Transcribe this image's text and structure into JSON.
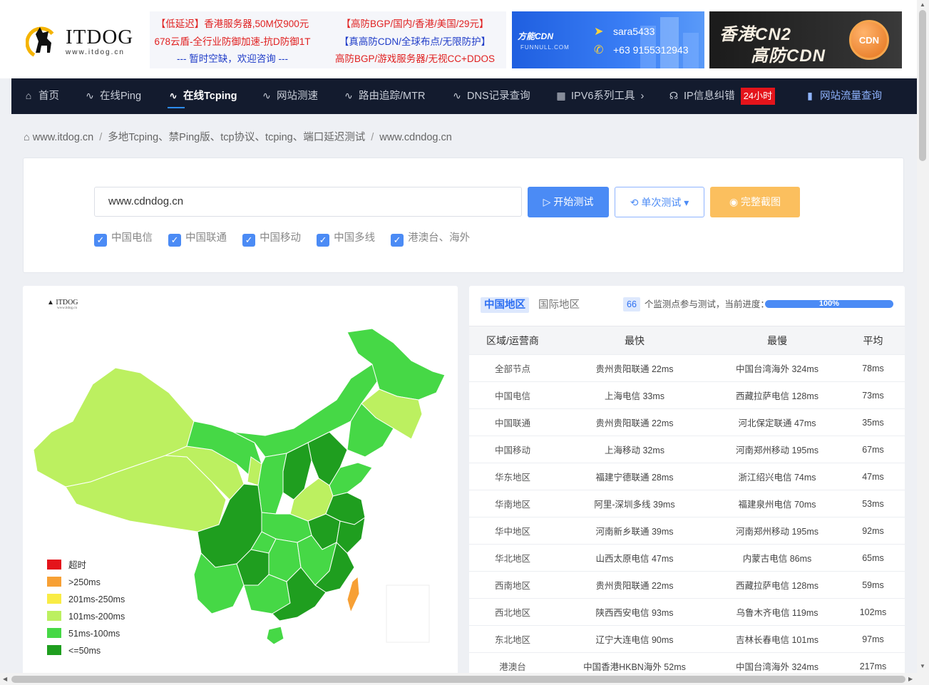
{
  "logo": {
    "title": "ITDOG",
    "url": "www.itdog.cn"
  },
  "ads": {
    "left": [
      "【低延迟】香港服务器,50M仅900元",
      "678云盾-全行业防御加速-抗D防御1T",
      "--- 暂时空缺，欢迎咨询 ---"
    ],
    "right": [
      "【高防BGP/国内/香港/美国/29元】",
      "【真高防CDN/全球布点/无限防护】",
      "高防BGP/游戏服务器/无视CC+DDOS"
    ]
  },
  "funnull": {
    "brand": "方能CDN",
    "brand_sub": "FUNNULL.COM",
    "telegram": "sara5433",
    "phone": "+63 9155312943"
  },
  "cn2_ad": {
    "line1": "香港CN2",
    "line2": "高防CDN",
    "badge": "CDN"
  },
  "nav": {
    "items": [
      "首页",
      "在线Ping",
      "在线Tcping",
      "网站测速",
      "路由追踪/MTR",
      "DNS记录查询",
      "IPV6系列工具",
      "IP信息纠错",
      "网站流量查询"
    ],
    "hot_badge": "24小时"
  },
  "breadcrumb": [
    "www.itdog.cn",
    "多地Tcping、禁Ping版、tcp协议、tcping、端口延迟测试",
    "www.cdndog.cn"
  ],
  "search": {
    "value": "www.cdndog.cn",
    "start_label": "开始测试",
    "mode_label": "单次测试",
    "screenshot_label": "完整截图"
  },
  "checkboxes": [
    "中国电信",
    "中国联通",
    "中国移动",
    "中国多线",
    "港澳台、海外"
  ],
  "map": {
    "logo": "ITDOG",
    "logo_url": "www.itdog.cn",
    "legend": [
      "超时",
      ">250ms",
      "201ms-250ms",
      "101ms-200ms",
      "51ms-100ms",
      "<=50ms"
    ],
    "colors": [
      "#e4141b",
      "#f7a035",
      "#f9ec45",
      "#bcf060",
      "#46d846",
      "#1f9e1f"
    ]
  },
  "results": {
    "tabs": [
      "中国地区",
      "国际地区"
    ],
    "node_count": "66",
    "progress_text": "个监测点参与测试，当前进度：",
    "progress": "100%",
    "headers": [
      "区域/运营商",
      "最快",
      "最慢",
      "平均"
    ],
    "rows": [
      [
        "全部节点",
        "贵州贵阳联通 22ms",
        "中国台湾海外 324ms",
        "78ms"
      ],
      [
        "中国电信",
        "上海电信 33ms",
        "西藏拉萨电信 128ms",
        "73ms"
      ],
      [
        "中国联通",
        "贵州贵阳联通 22ms",
        "河北保定联通 47ms",
        "35ms"
      ],
      [
        "中国移动",
        "上海移动 32ms",
        "河南郑州移动 195ms",
        "67ms"
      ],
      [
        "华东地区",
        "福建宁德联通 28ms",
        "浙江绍兴电信 74ms",
        "47ms"
      ],
      [
        "华南地区",
        "阿里-深圳多线 39ms",
        "福建泉州电信 70ms",
        "53ms"
      ],
      [
        "华中地区",
        "河南新乡联通 39ms",
        "河南郑州移动 195ms",
        "92ms"
      ],
      [
        "华北地区",
        "山西太原电信 47ms",
        "内蒙古电信 86ms",
        "65ms"
      ],
      [
        "西南地区",
        "贵州贵阳联通 22ms",
        "西藏拉萨电信 128ms",
        "59ms"
      ],
      [
        "西北地区",
        "陕西西安电信 93ms",
        "乌鲁木齐电信 119ms",
        "102ms"
      ],
      [
        "东北地区",
        "辽宁大连电信 90ms",
        "吉林长春电信 101ms",
        "97ms"
      ],
      [
        "港澳台",
        "中国香港HKBN海外 52ms",
        "中国台湾海外 324ms",
        "217ms"
      ]
    ]
  }
}
